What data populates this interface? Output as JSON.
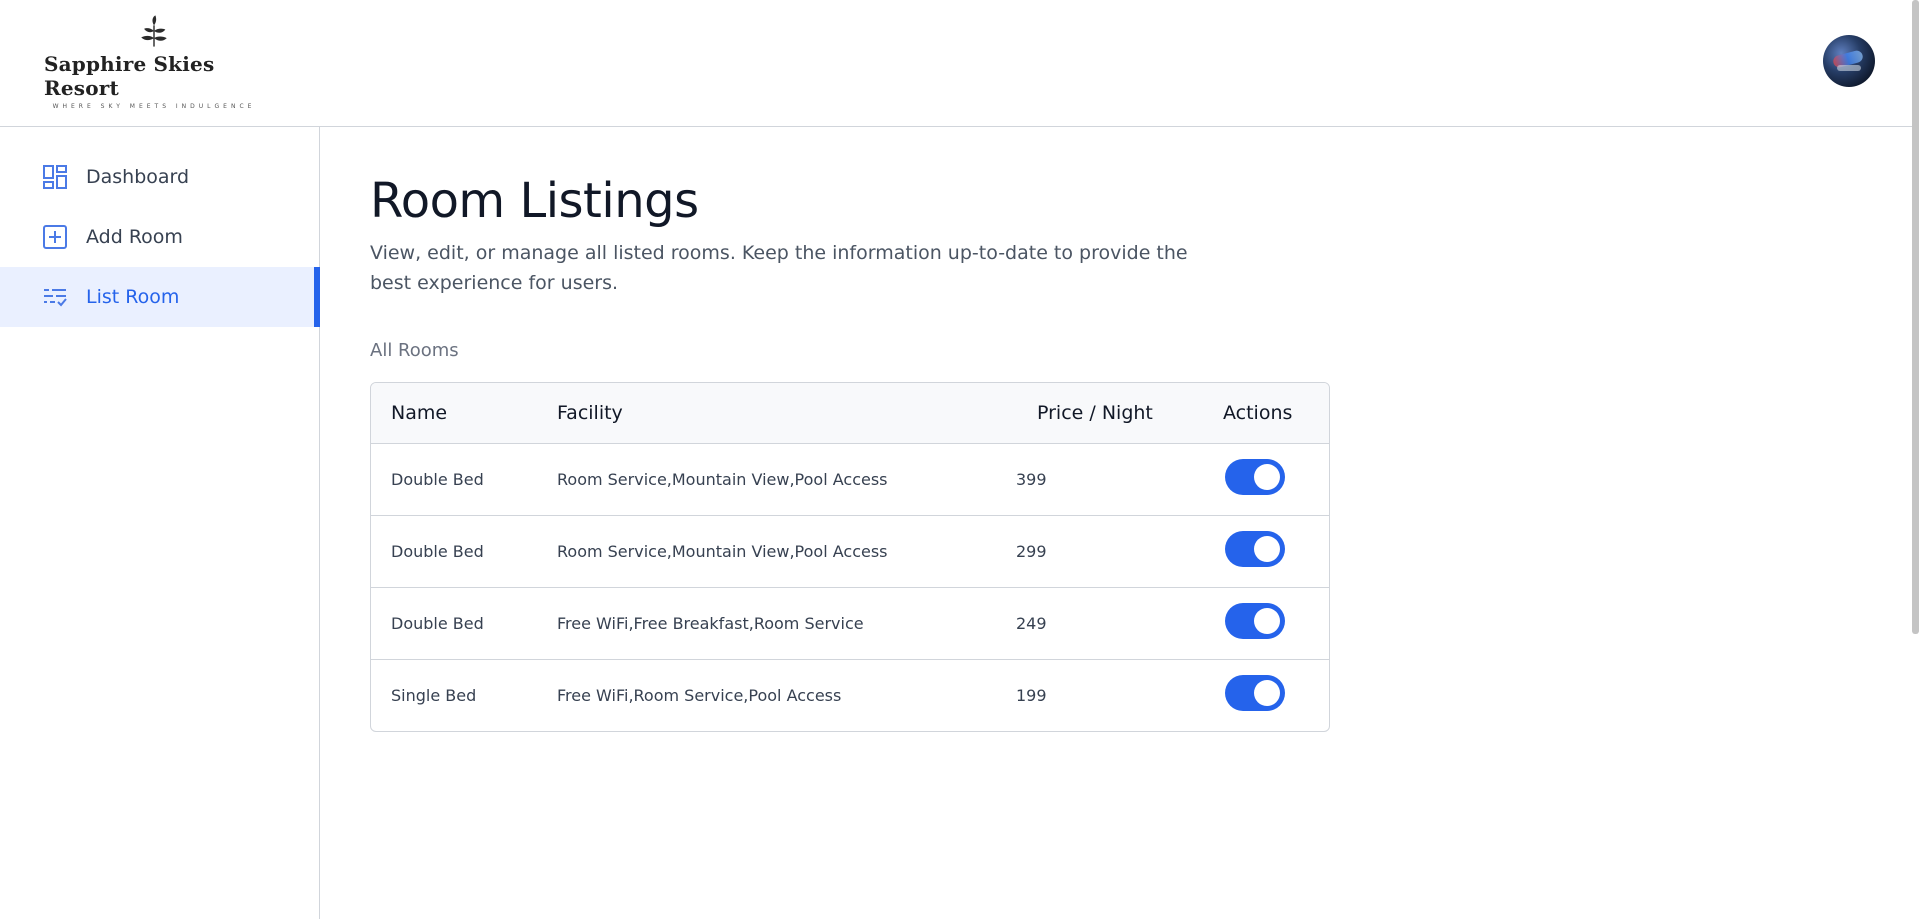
{
  "brand": {
    "name": "Sapphire Skies Resort",
    "tagline": "WHERE SKY MEETS INDULGENCE",
    "accent": "#2563eb"
  },
  "sidebar": {
    "items": [
      {
        "label": "Dashboard",
        "icon": "dashboard-icon",
        "active": false
      },
      {
        "label": "Add Room",
        "icon": "add-square-icon",
        "active": false
      },
      {
        "label": "List Room",
        "icon": "list-check-icon",
        "active": true
      }
    ]
  },
  "main": {
    "title": "Room Listings",
    "description": "View, edit, or manage all listed rooms. Keep the information up-to-date to provide the best experience for users.",
    "section_label": "All Rooms",
    "table": {
      "columns": [
        "Name",
        "Facility",
        "Price / Night",
        "Actions"
      ],
      "rows": [
        {
          "name": "Double Bed",
          "facility": "Room Service,Mountain View,Pool Access",
          "price": "399",
          "available": true
        },
        {
          "name": "Double Bed",
          "facility": "Room Service,Mountain View,Pool Access",
          "price": "299",
          "available": true
        },
        {
          "name": "Double Bed",
          "facility": "Free WiFi,Free Breakfast,Room Service",
          "price": "249",
          "available": true
        },
        {
          "name": "Single Bed",
          "facility": "Free WiFi,Room Service,Pool Access",
          "price": "199",
          "available": true
        }
      ]
    }
  }
}
